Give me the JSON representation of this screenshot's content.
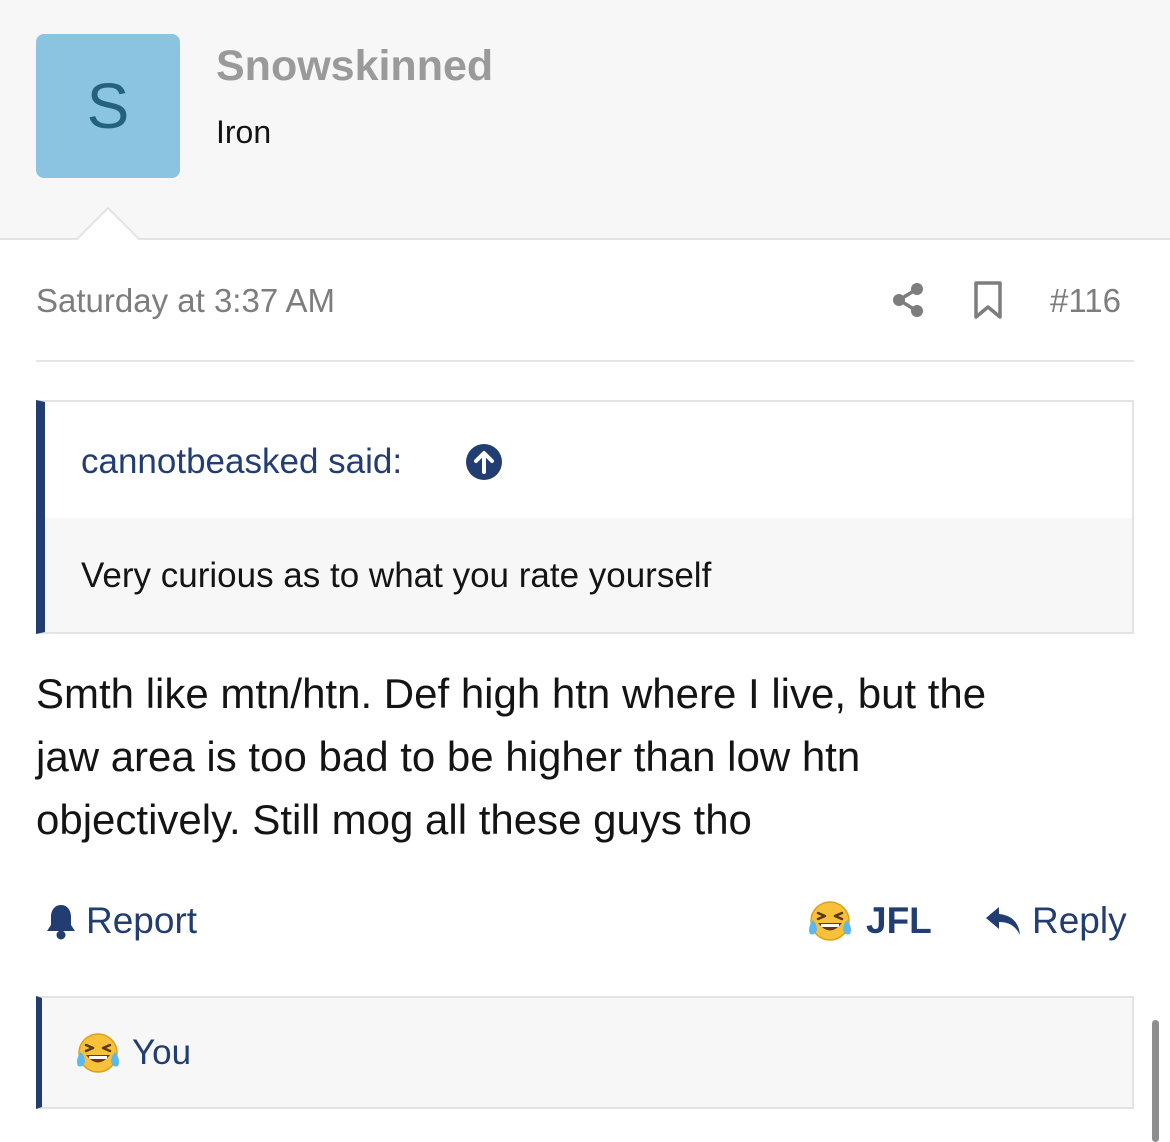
{
  "user": {
    "avatar_letter": "S",
    "avatar_color": "#8ac4e1",
    "username": "Snowskinned",
    "title": "Iron"
  },
  "meta": {
    "date": "Saturday at 3:37 AM",
    "post_number": "#116",
    "icons": [
      "share-icon",
      "bookmark-icon"
    ]
  },
  "quote": {
    "author_label": "cannotbeasked said:",
    "text": "Very curious as to what you rate yourself",
    "jump_icon": "arrow-up-circle-icon"
  },
  "message": {
    "lines": [
      "Smth like mtn/htn. Def high htn where I live, but the",
      "jaw area is too bad to be higher than low htn",
      "objectively. Still mog all these guys tho"
    ]
  },
  "actions": {
    "report_label": "Report",
    "reaction_label": "JFL",
    "reply_label": "Reply"
  },
  "reactions_bar": {
    "label": "You",
    "icon": "laughing-tears-emoji"
  },
  "colors": {
    "accent": "#223d72",
    "muted": "#7d7d7d",
    "header_bg": "#f7f7f7"
  }
}
